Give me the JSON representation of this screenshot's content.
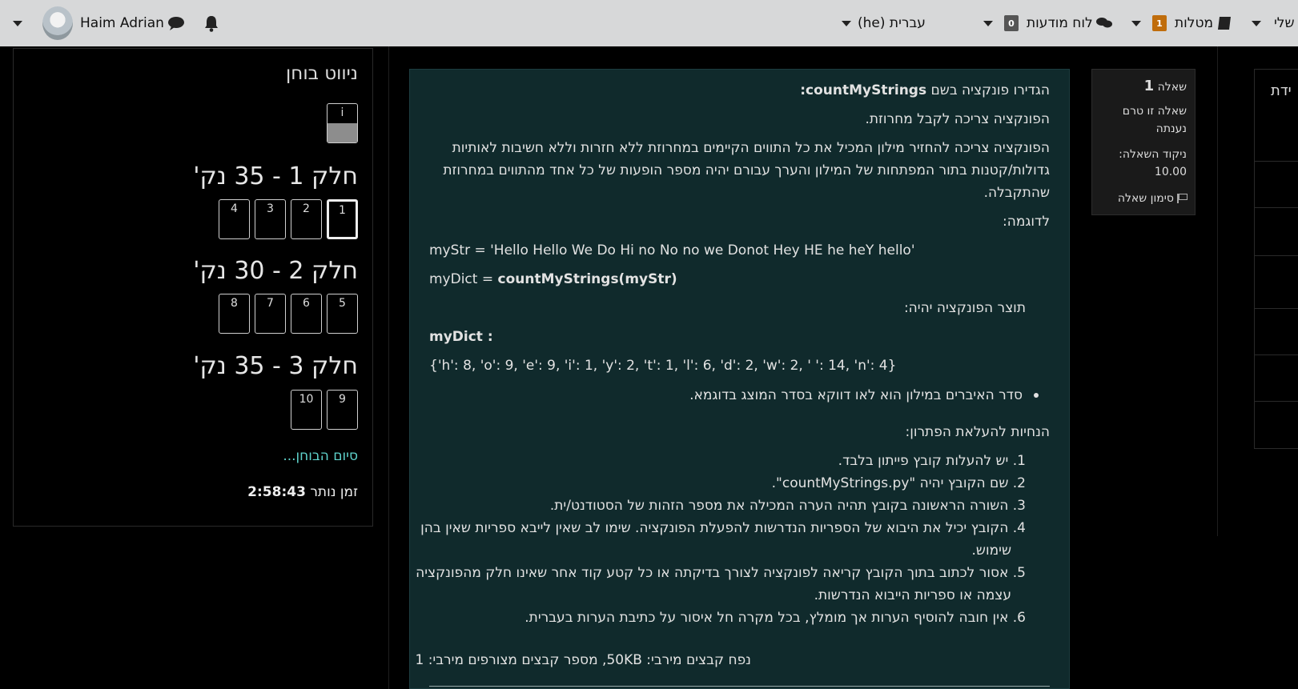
{
  "navbar": {
    "user_name": "Haim Adrian",
    "language": "עברית (he)",
    "forums_label": "לוח מודעות",
    "forums_count": "0",
    "tasks_label": "מטלות",
    "tasks_count": "1",
    "my_label": "שלי"
  },
  "quiz_nav": {
    "title": "ניווט בוחן",
    "info_label": "i",
    "sections": [
      {
        "title": "חלק 1 - 35 נק'",
        "questions": [
          "1",
          "2",
          "3",
          "4"
        ]
      },
      {
        "title": "חלק 2 - 30 נק'",
        "questions": [
          "5",
          "6",
          "7",
          "8"
        ]
      },
      {
        "title": "חלק 3 - 35 נק'",
        "questions": [
          "9",
          "10"
        ]
      }
    ],
    "finish_label": "סיום הבוחן...",
    "timer_label": "זמן נותר",
    "timer_value": "2:58:43"
  },
  "question_info": {
    "label": "שאלה",
    "number": "1",
    "status_line1": "שאלה זו טרם",
    "status_line2": "נענתה",
    "marks_label": "ניקוד השאלה:",
    "marks_value": "10.00",
    "flag_label": "סימון שאלה",
    "right_partial": "ידת"
  },
  "question": {
    "intro_prefix": "הגדירו פונקציה בשם",
    "function_name": "countMyStrings:",
    "line2": "הפונקציה צריכה לקבל מחרוזת.",
    "para_line1": "הפונקציה צריכה להחזיר מילון המכיל את כל התווים הקיימים במחרוזת ללא חזרות וללא חשיבות לאותיות",
    "para_line2": "גדולות/קטנות בתור המפתחות של המילון והערך עבורם יהיה מספר הופעות של כל אחד מהתווים במחרוזת",
    "para_line3": "שהתקבלה.",
    "example_label": "לדוגמה:",
    "code_line1": "myStr = 'Hello Hello We Do Hi no No no we Donot Hey HE he heY hello'",
    "code_line2_prefix": "myDict = ",
    "code_line2_bold": "countMyStrings(myStr)",
    "output_label": "תוצר הפונקציה יהיה:",
    "dict_label": "myDict :",
    "dict_value": "{'h': 8, 'o': 9, 'e': 9, 'i': 1, 'y': 2, 't': 1, 'l': 6, 'd': 2, 'w': 2, ' ': 14, 'n': 4}",
    "bullet": "סדר האיברים במילון הוא לאו דווקא בסדר המוצג בדוגמא.",
    "instructions_title": "הנחיות להעלאת הפתרון:",
    "instructions": [
      "1. יש להעלות קובץ פייתון בלבד.",
      "2. שם הקובץ יהיה \"countMyStrings.py\".",
      "3. השורה הראשונה בקובץ תהיה הערה המכילה את מספר הזהות של הסטודנט/ית.",
      "4. הקובץ יכיל את היבוא של הספריות הנדרשות להפעלת הפונקציה. שימו לב שאין לייבא ספריות שאין בהן",
      "שימוש.",
      "5. אסור לכתוב בתוך הקובץ קריאה לפונקציה לצורך בדיקתה או כל קטע קוד אחר שאינו חלק מהפונקציה",
      "עצמה או ספריות הייבוא הנדרשות.",
      "6. אין חובה להוסיף הערות אך מומלץ, בכל מקרה חל איסור על כתיבת הערות בעברית."
    ],
    "file_limits": "נפח קבצים מירבי: 50KB, מספר קבצים מצורפים מירבי: 1"
  }
}
